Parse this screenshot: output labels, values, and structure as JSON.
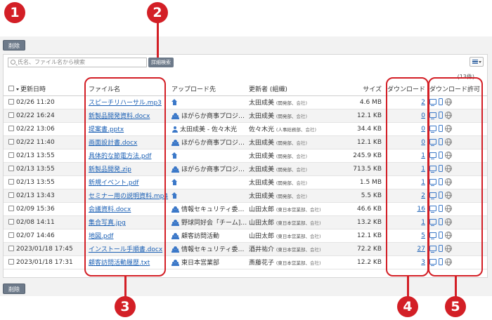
{
  "toolbar": {
    "delete_label": "削除",
    "search_placeholder": "氏名、ファイル名から検索",
    "advanced_search_label": "詳細検索",
    "result_count": "(13件)"
  },
  "table": {
    "headers": {
      "date": "更新日時",
      "file": "ファイル名",
      "upload_to": "アップロード先",
      "updater": "更新者 (組織)",
      "size": "サイズ",
      "downloads": "ダウンロード",
      "permission": "ダウンロード許可"
    },
    "rows": [
      {
        "date": "02/26 11:20",
        "file": "スピーチリハーサル.mp3",
        "dest_icon": "home-icon",
        "dest": "",
        "updater": "太田成美",
        "dept": "(開発部、",
        "company": "会社)",
        "size": "4.6 MB",
        "downloads": "2"
      },
      {
        "date": "02/22 16:24",
        "file": "新製品開発資料.docx",
        "dest_icon": "group-icon",
        "dest": "ほがらか商事プロジ…",
        "updater": "太田成美",
        "dept": "(開発部、",
        "company": "会社)",
        "size": "12.1 KB",
        "downloads": "0"
      },
      {
        "date": "02/22 13:06",
        "file": "提案書.pptx",
        "dest_icon": "user-icon",
        "dest": "太田成美 - 佐々木光",
        "updater": "佐々木光",
        "dept": "(人事総務部、",
        "company": "会社)",
        "size": "34.4 KB",
        "downloads": "0"
      },
      {
        "date": "02/22 11:40",
        "file": "画面設計書.docx",
        "dest_icon": "group-icon",
        "dest": "ほがらか商事プロジ…",
        "updater": "太田成美",
        "dept": "(開発部、",
        "company": "会社)",
        "size": "12.1 KB",
        "downloads": "0"
      },
      {
        "date": "02/13 13:55",
        "file": "具体的な節電方法.pdf",
        "dest_icon": "home-icon",
        "dest": "",
        "updater": "太田成美",
        "dept": "(開発部、",
        "company": "会社)",
        "size": "245.9 KB",
        "downloads": "1"
      },
      {
        "date": "02/13 13:55",
        "file": "新製品開発.zip",
        "dest_icon": "group-icon",
        "dest": "ほがらか商事プロジ…",
        "updater": "太田成美",
        "dept": "(開発部、",
        "company": "会社)",
        "size": "713.5 KB",
        "downloads": "1"
      },
      {
        "date": "02/13 13:55",
        "file": "新規イベント.pdf",
        "dest_icon": "home-icon",
        "dest": "",
        "updater": "太田成美",
        "dept": "(開発部、",
        "company": "会社)",
        "size": "1.5 MB",
        "downloads": "1"
      },
      {
        "date": "02/13 13:43",
        "file": "セミナー用の説明資料.mp4",
        "dest_icon": "home-icon",
        "dest": "",
        "updater": "太田成美",
        "dept": "(開発部、",
        "company": "会社)",
        "size": "5.5 KB",
        "downloads": "2"
      },
      {
        "date": "02/09 15:36",
        "file": "会議資料.docx",
        "dest_icon": "group-icon",
        "dest": "情報セキュリティ委…",
        "updater": "山田太郎",
        "dept": "(東日本営業部、",
        "company": "会社)",
        "size": "46.6 KB",
        "downloads": "16"
      },
      {
        "date": "02/08 14:11",
        "file": "集合写真.jpg",
        "dest_icon": "group-icon",
        "dest": "野球同好会「チーム]…",
        "updater": "山田太郎",
        "dept": "(東日本営業部、",
        "company": "会社)",
        "size": "13.2 KB",
        "downloads": "1"
      },
      {
        "date": "02/07 14:46",
        "file": "地図.pdf",
        "dest_icon": "group-icon",
        "dest": "顧客訪問活動",
        "updater": "山田太郎",
        "dept": "(東日本営業部、",
        "company": "会社)",
        "size": "12.1 KB",
        "downloads": "5"
      },
      {
        "date": "2023/01/18 17:45",
        "file": "インストール手順書.docx",
        "dest_icon": "group-icon",
        "dest": "情報セキュリティ委…",
        "updater": "酒井祐介",
        "dept": "(東日本営業部、",
        "company": "会社)",
        "size": "72.2 KB",
        "downloads": "27"
      },
      {
        "date": "2023/01/18 17:31",
        "file": "顧客訪問活動履歴.txt",
        "dest_icon": "group-icon",
        "dest": "東日本営業部",
        "updater": "斎藤花子",
        "dept": "(東日本営業部、",
        "company": "会社)",
        "size": "12.2 KB",
        "downloads": "3"
      }
    ]
  },
  "markers": [
    "1",
    "2",
    "3",
    "4",
    "5"
  ],
  "colors": {
    "highlight": "#d31f26",
    "link": "#1a5fb4",
    "icon_blue": "#3b78c8",
    "button_gray": "#6d7a8a"
  }
}
